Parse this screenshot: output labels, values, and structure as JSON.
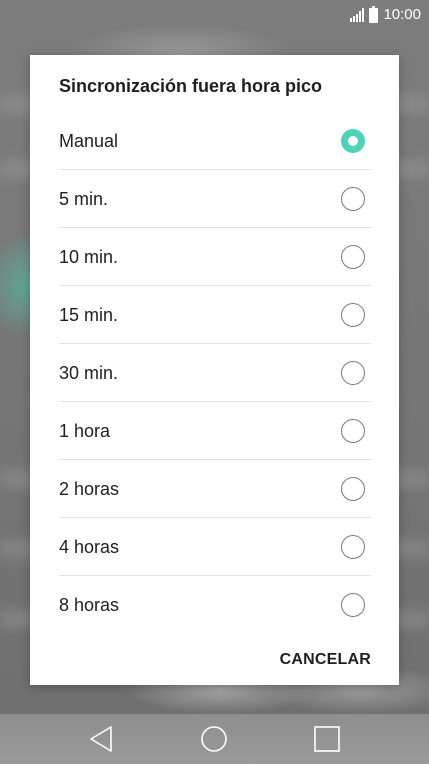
{
  "status_bar": {
    "time": "10:00",
    "icons": [
      "signal-icon",
      "battery-icon"
    ]
  },
  "dialog": {
    "title": "Sincronización fuera hora pico",
    "options": [
      {
        "label": "Manual",
        "selected": true
      },
      {
        "label": "5 min.",
        "selected": false
      },
      {
        "label": "10 min.",
        "selected": false
      },
      {
        "label": "15 min.",
        "selected": false
      },
      {
        "label": "30 min.",
        "selected": false
      },
      {
        "label": "1 hora",
        "selected": false
      },
      {
        "label": "2 horas",
        "selected": false
      },
      {
        "label": "4 horas",
        "selected": false
      },
      {
        "label": "8 horas",
        "selected": false
      }
    ],
    "cancel_label": "CANCELAR"
  },
  "navigation_bar": {
    "buttons": [
      "back-icon",
      "home-icon",
      "recent-apps-icon"
    ]
  },
  "colors": {
    "accent": "#4fd3b8",
    "dialog_background": "#ffffff",
    "text": "#1f1f1f"
  }
}
